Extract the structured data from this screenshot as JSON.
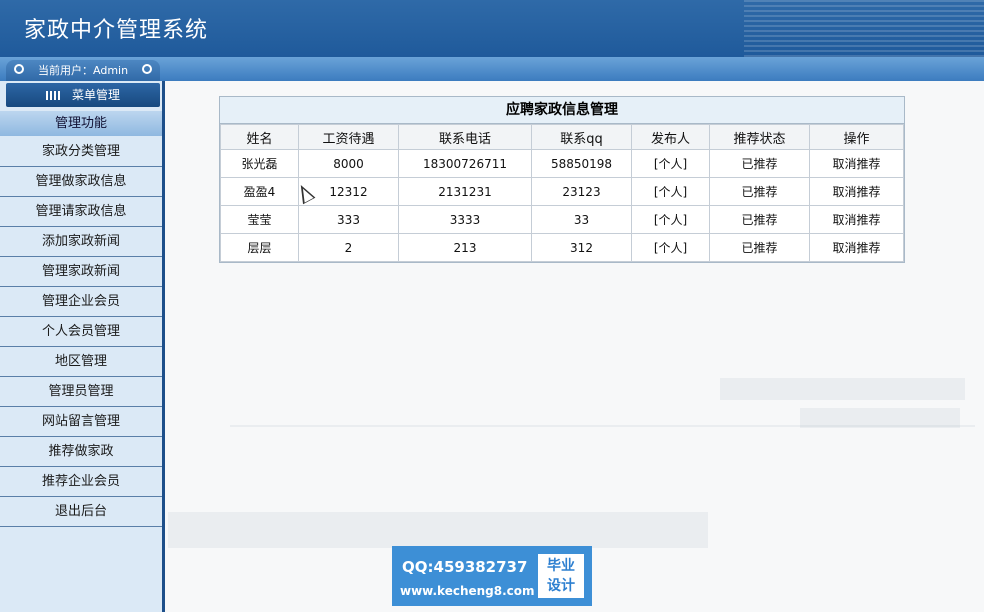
{
  "header": {
    "title": "家政中介管理系统"
  },
  "user_tab": {
    "label": "当前用户：Admin"
  },
  "menu": {
    "head_label": "菜单管理",
    "section_label": "管理功能"
  },
  "sidebar": {
    "items": [
      {
        "label": "家政分类管理"
      },
      {
        "label": "管理做家政信息"
      },
      {
        "label": "管理请家政信息"
      },
      {
        "label": "添加家政新闻"
      },
      {
        "label": "管理家政新闻"
      },
      {
        "label": "管理企业会员"
      },
      {
        "label": "个人会员管理"
      },
      {
        "label": "地区管理"
      },
      {
        "label": "管理员管理"
      },
      {
        "label": "网站留言管理"
      },
      {
        "label": "推荐做家政"
      },
      {
        "label": "推荐企业会员"
      },
      {
        "label": "退出后台"
      }
    ]
  },
  "panel": {
    "title": "应聘家政信息管理",
    "columns": [
      "姓名",
      "工资待遇",
      "联系电话",
      "联系qq",
      "发布人",
      "推荐状态",
      "操作"
    ],
    "rows": [
      {
        "name": "张光磊",
        "salary": "8000",
        "phone": "18300726711",
        "qq": "58850198",
        "publisher": "[个人]",
        "status": "已推荐",
        "action": "取消推荐"
      },
      {
        "name": "盈盈4",
        "salary": "12312",
        "phone": "2131231",
        "qq": "23123",
        "publisher": "[个人]",
        "status": "已推荐",
        "action": "取消推荐"
      },
      {
        "name": "莹莹",
        "salary": "333",
        "phone": "3333",
        "qq": "33",
        "publisher": "[个人]",
        "status": "已推荐",
        "action": "取消推荐"
      },
      {
        "name": "层层",
        "salary": "2",
        "phone": "213",
        "qq": "312",
        "publisher": "[个人]",
        "status": "已推荐",
        "action": "取消推荐"
      }
    ]
  },
  "watermark": {
    "qq": "QQ:459382737",
    "url": "www.kecheng8.com",
    "badge_line1": "毕业",
    "badge_line2": "设计"
  }
}
